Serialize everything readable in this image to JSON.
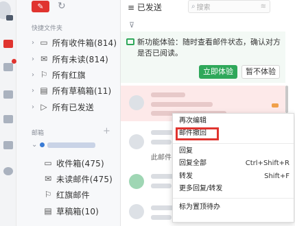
{
  "rail": {
    "icons": [
      "avatar-icon",
      "mail-icon",
      "folder-icon",
      "calendar-icon",
      "contacts-icon",
      "ai-icon",
      "settings-icon"
    ],
    "colors": {
      "accent": "#e0342f",
      "rail_bg": "#f3f4f6"
    }
  },
  "folders": {
    "compose_icon": "edit-icon",
    "refresh_icon": "refresh-icon",
    "quick_section": "快捷文件夹",
    "quick_items": [
      {
        "label": "所有收件箱(814)",
        "icon": "inbox-icon"
      },
      {
        "label": "所有未读(814)",
        "icon": "unread-icon"
      },
      {
        "label": "所有红旗",
        "icon": "flag-icon"
      },
      {
        "label": "所有草稿箱(11)",
        "icon": "draft-icon"
      },
      {
        "label": "所有已发送",
        "icon": "sent-icon"
      }
    ],
    "mailbox_section": "邮箱",
    "mailbox_items": [
      {
        "label": "收件箱(475)",
        "icon": "inbox-icon"
      },
      {
        "label": "未读邮件(475)",
        "icon": "unread-icon"
      },
      {
        "label": "红旗邮件",
        "icon": "flag-icon"
      },
      {
        "label": "草稿箱(10)",
        "icon": "draft-icon"
      }
    ]
  },
  "main": {
    "title": "≡ 已发送",
    "search_placeholder": "搜索",
    "notice_text": "新功能体验：随时查看邮件状态，确认对方是否已阅读。",
    "try_button": "立即体验",
    "skip_button": "暂不体验",
    "partial_row_text": "此邮件"
  },
  "context_menu": {
    "items": [
      {
        "label": "再次编辑",
        "shortcut": ""
      },
      {
        "label": "邮件撤回",
        "shortcut": ""
      },
      {
        "label": "回复",
        "shortcut": ""
      },
      {
        "label": "回复全部",
        "shortcut": "Ctrl+Shift+R"
      },
      {
        "label": "转发",
        "shortcut": "Shift+F"
      },
      {
        "label": "更多回复/转发",
        "shortcut": ""
      },
      {
        "label": "标为置顶待办",
        "shortcut": ""
      }
    ]
  }
}
